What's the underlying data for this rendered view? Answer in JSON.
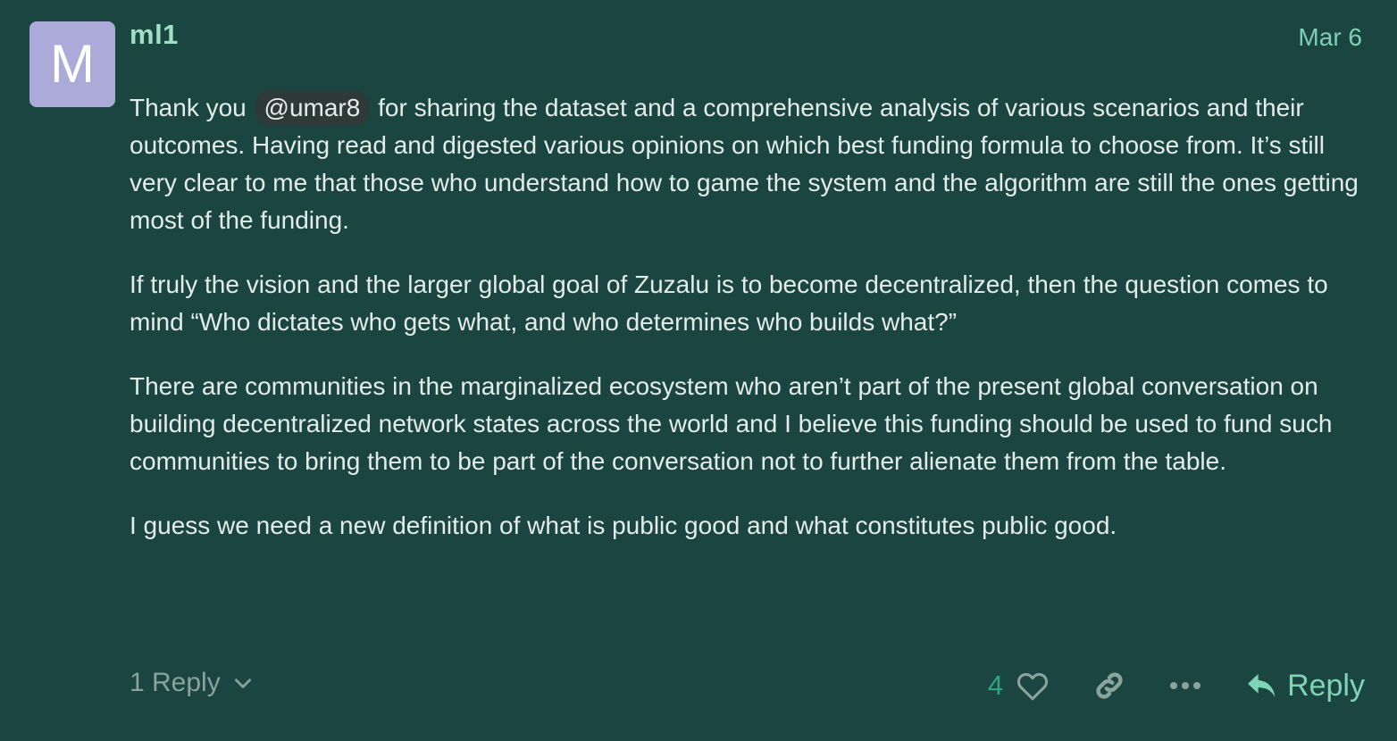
{
  "post": {
    "avatar_letter": "M",
    "username": "ml1",
    "date": "Mar 6",
    "paragraphs": {
      "p1_before": "Thank you",
      "p1_mention": "@umar8",
      "p1_after": "for sharing the dataset and a comprehensive analysis of various scenarios and their outcomes. Having read and digested various opinions on which best funding formula to choose from. It’s still very clear to me that those who understand how to game the system and the algorithm are still the ones getting most of the funding.",
      "p2": "If truly the vision and the larger global goal of Zuzalu is to become decentralized, then the question comes to mind “Who dictates who gets what, and who determines who builds what?”",
      "p3": "There are communities in the marginalized ecosystem who aren’t part of the present global conversation on building decentralized network states across the world and I believe this funding should be used to fund such communities to bring them to be part of the conversation not to further alienate them from the table.",
      "p4": "I guess we need a new definition of what is public good and what constitutes public good."
    }
  },
  "footer": {
    "replies_label": "1 Reply",
    "like_count": "4",
    "reply_label": "Reply"
  },
  "colors": {
    "background": "#1b4540",
    "username": "#9de0c4",
    "accent": "#2fa483",
    "avatar": "#acaad9"
  },
  "icons": [
    "chevron-down-icon",
    "heart-icon",
    "link-icon",
    "more-icon",
    "reply-arrow-icon"
  ]
}
